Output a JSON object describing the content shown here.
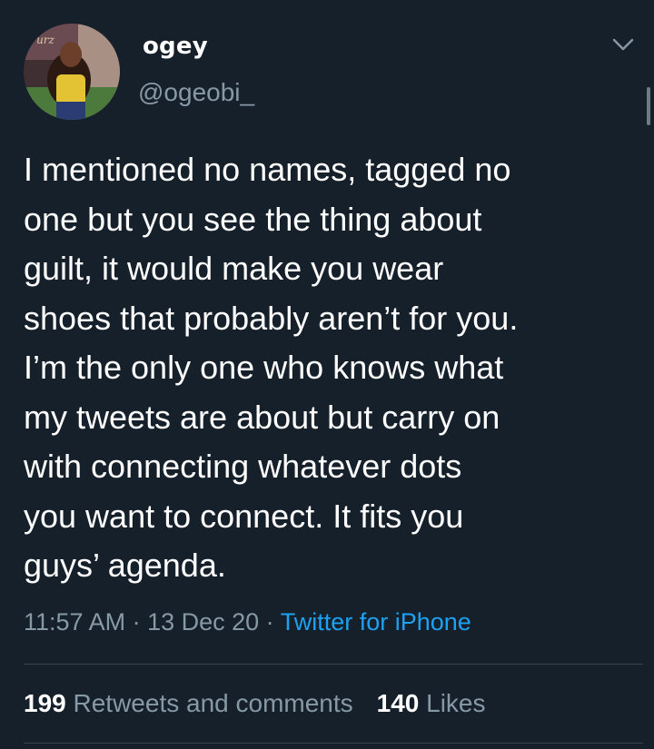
{
  "user": {
    "display_name": "ogey",
    "handle": "@ogeobi_"
  },
  "tweet": {
    "text": "I mentioned no names, tagged no\none but you see the thing about\nguilt, it would make you wear\nshoes that probably aren’t for you.\nI’m the only one who knows what\nmy tweets are about but carry on\nwith connecting whatever dots\nyou want to connect. It fits you\nguys’ agenda.",
    "time": "11:57 AM",
    "separator": " · ",
    "date": "13 Dec 20",
    "source": "Twitter for iPhone"
  },
  "stats": {
    "retweets_count": "199",
    "retweets_label": "Retweets and comments",
    "likes_count": "140",
    "likes_label": "Likes"
  },
  "icons": {
    "menu": "chevron-down-icon"
  },
  "colors": {
    "background": "#15202b",
    "text_primary": "#ffffff",
    "text_secondary": "#8899a6",
    "link": "#1da1f2",
    "divider": "#38444d"
  }
}
